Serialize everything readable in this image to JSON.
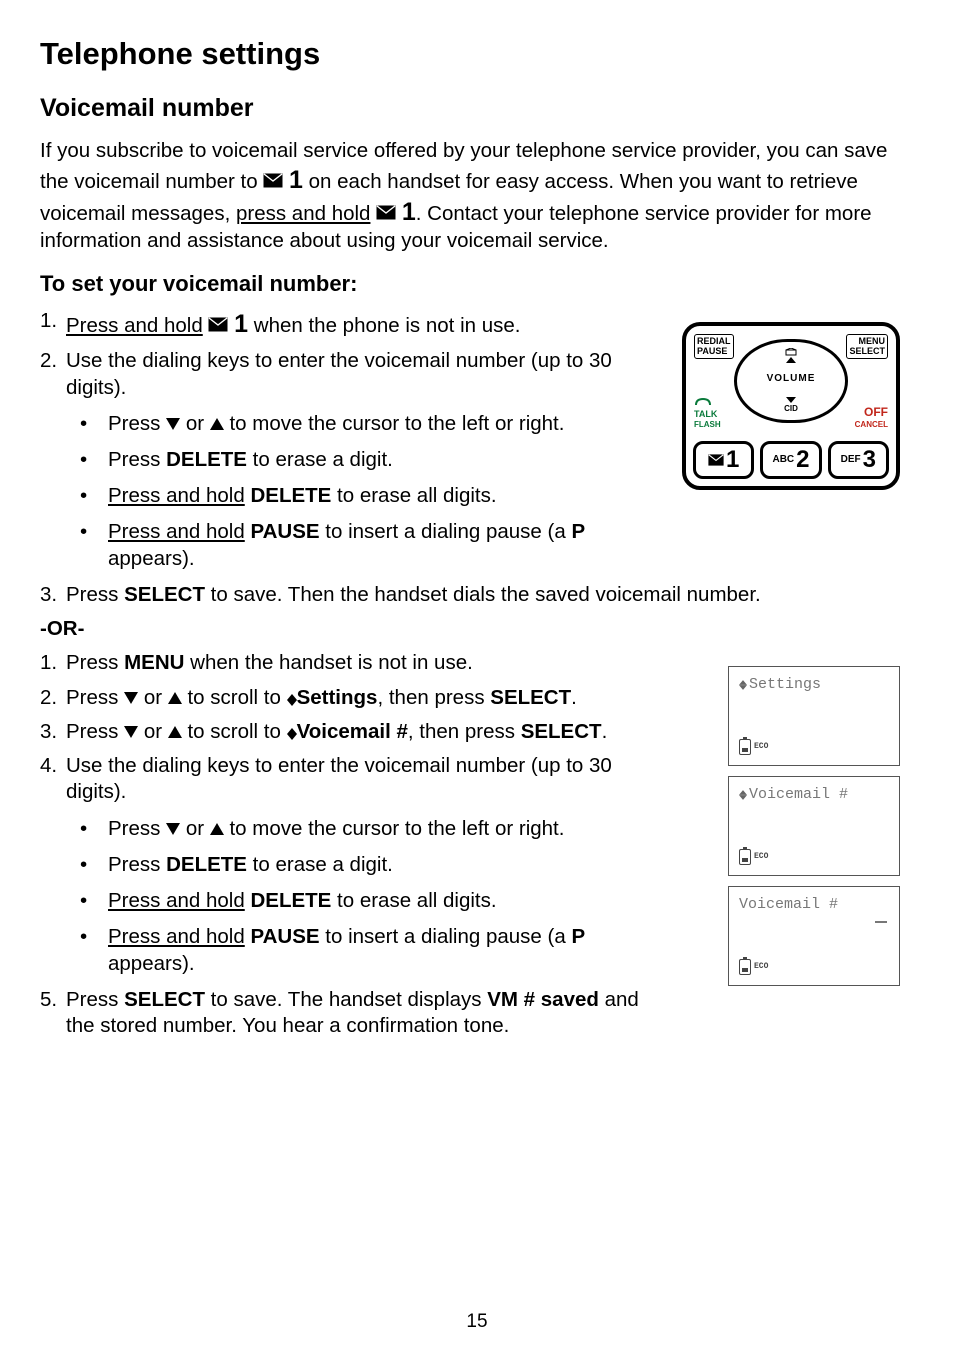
{
  "page": {
    "title": "Telephone settings",
    "section": "Voicemail number",
    "intro_pre": "If you subscribe to voicemail service offered by your telephone service provider, you can save the voicemail number to ",
    "intro_key": "1",
    "intro_mid": " on each handset for easy access. When you want to retrieve voicemail messages, ",
    "intro_hold": "press and hold",
    "intro_key2": "1",
    "intro_end": ". Contact your telephone service provider for more information and assistance about using your voicemail service.",
    "set_heading": "To set your voicemail number:",
    "or": "-OR-",
    "page_number": "15"
  },
  "method1": {
    "s1_n": "1.",
    "s1_a": "Press and hold",
    "s1_key": "1",
    "s1_b": "when the phone is not in use.",
    "s2_n": "2.",
    "s2": "Use the dialing keys to enter the voicemail number (up to 30 digits).",
    "b1a": "Press ",
    "b1b": " or ",
    "b1c": " to move the cursor to the left or right.",
    "b2a": "Press ",
    "b2b": "DELETE",
    "b2c": " to erase a digit.",
    "b3a": "Press and hold",
    "b3b": "DELETE",
    "b3c": " to erase all digits.",
    "b4a": "Press and hold",
    "b4b": "PAUSE",
    "b4c": " to insert a dialing pause (a ",
    "b4d": "P",
    "b4e": " appears).",
    "s3_n": "3.",
    "s3a": "Press ",
    "s3b": "SELECT",
    "s3c": " to save. Then the handset dials the saved voicemail number."
  },
  "method2": {
    "s1_n": "1.",
    "s1a": "Press ",
    "s1b": "MENU",
    "s1c": " when the handset is not in use.",
    "s2_n": "2.",
    "s2a": "Press ",
    "s2b": " or ",
    "s2c": " to scroll to ",
    "s2d": "Settings",
    "s2e": ", then press ",
    "s2f": "SELECT",
    "s2g": ".",
    "s3_n": "3.",
    "s3a": "Press ",
    "s3b": " or ",
    "s3c": " to scroll to ",
    "s3d": "Voicemail #",
    "s3e": ", then press ",
    "s3f": "SELECT",
    "s3g": ".",
    "s4_n": "4.",
    "s4": "Use the dialing keys to enter the voicemail number (up to 30 digits).",
    "b1a": "Press ",
    "b1b": " or ",
    "b1c": " to move the cursor to the left or right.",
    "b2a": "Press ",
    "b2b": "DELETE",
    "b2c": " to erase a digit.",
    "b3a": "Press and hold",
    "b3b": "DELETE",
    "b3c": " to erase all digits.",
    "b4a": "Press and hold",
    "b4b": "PAUSE",
    "b4c": " to insert a dialing pause (a ",
    "b4d": "P",
    "b4e": " appears).",
    "s5_n": "5.",
    "s5a": "Press ",
    "s5b": "SELECT",
    "s5c": " to save. The handset displays ",
    "s5d": "VM # saved",
    "s5e": " and the stored number. You hear a confirmation tone."
  },
  "keypad": {
    "redial": "REDIAL",
    "pause": "PAUSE",
    "menu": "MENU",
    "select": "SELECT",
    "talk": "TALK",
    "flash": "FLASH",
    "off": "OFF",
    "cancel": "CANCEL",
    "volume": "VOLUME",
    "cid": "CID",
    "k1_sub": "",
    "k1": "1",
    "k2_sub": "ABC",
    "k2": "2",
    "k3_sub": "DEF",
    "k3": "3"
  },
  "lcd": {
    "l1": "Settings",
    "eco": "ECO",
    "l2": "Voicemail #",
    "l3": "Voicemail #"
  }
}
